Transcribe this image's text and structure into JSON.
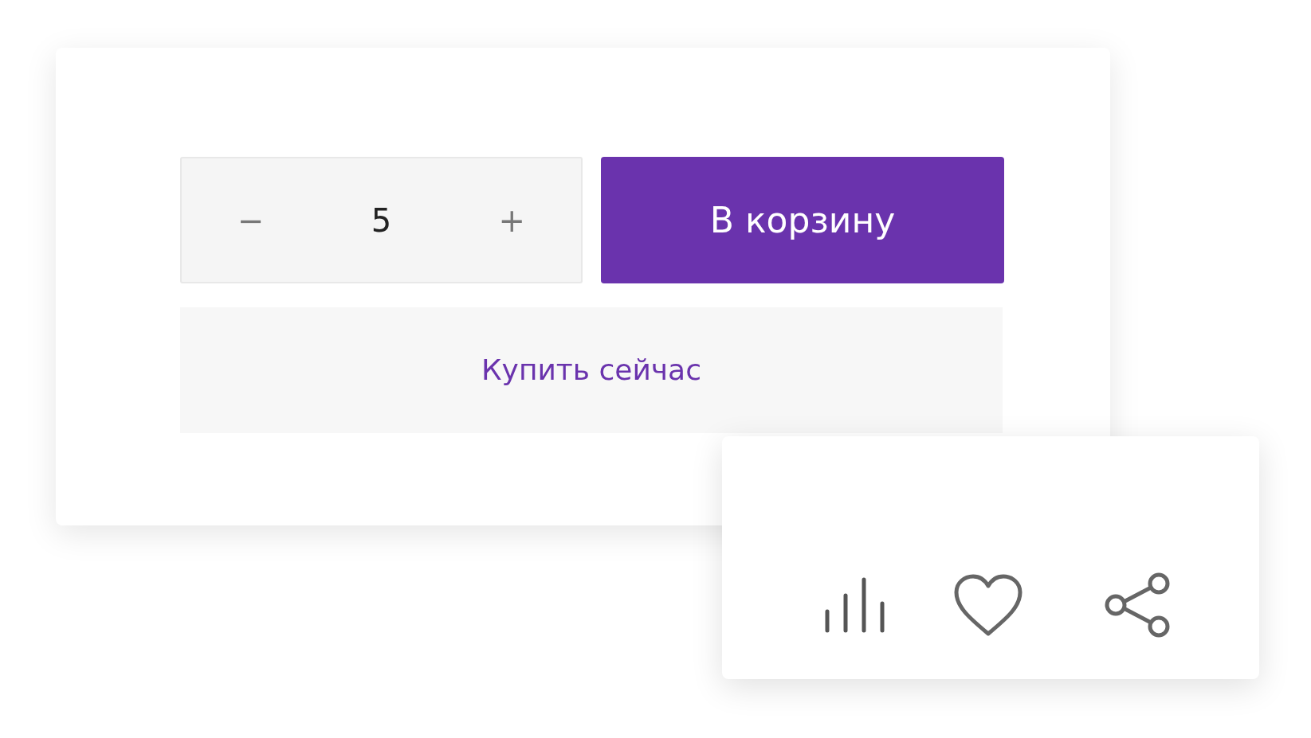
{
  "quantity": {
    "minus": "−",
    "value": "5",
    "plus": "+"
  },
  "add_to_cart": "В корзину",
  "buy_now": "Купить сейчас"
}
